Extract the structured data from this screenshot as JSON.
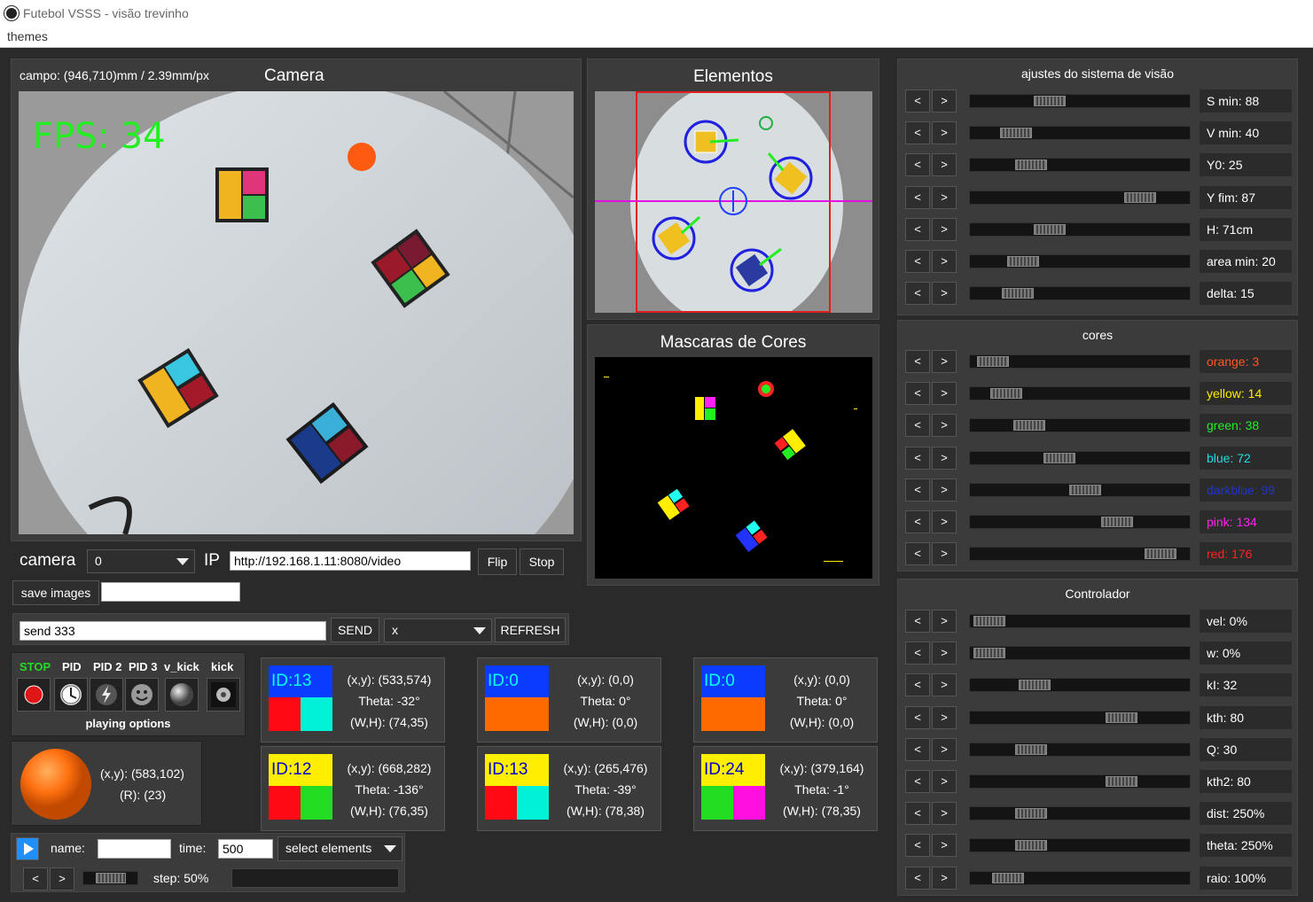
{
  "window": {
    "title": "Futebol VSSS - visão trevinho",
    "menu": [
      "themes"
    ]
  },
  "camera_panel": {
    "title": "Camera",
    "info": "campo: (946,710)mm / 2.39mm/px",
    "fps": "FPS: 34"
  },
  "elements_panel": {
    "title": "Elementos"
  },
  "masks_panel": {
    "title": "Mascaras de Cores"
  },
  "camera_controls": {
    "camera_label": "camera",
    "camera_select": "0",
    "ip_label": "IP",
    "ip_value": "http://192.168.1.11:8080/video",
    "flip": "Flip",
    "stop": "Stop",
    "save_images": "save images",
    "save_value": ""
  },
  "send_bar": {
    "value": "send 333",
    "send": "SEND",
    "select": "x",
    "refresh": "REFRESH"
  },
  "playing": {
    "labels": [
      "STOP",
      "PID",
      "PID 2",
      "PID 3",
      "v_kick",
      "kick"
    ],
    "footer": "playing options",
    "stop_color": "#22dd22"
  },
  "ball": {
    "xy": "(x,y): (583,102)",
    "r": "(R): (23)"
  },
  "robots": [
    {
      "id": "ID:13",
      "xy": "(x,y): (533,574)",
      "theta": "Theta: -32°",
      "wh": "(W,H): (74,35)",
      "team": "#0a3cff",
      "c1": "#ff0a14",
      "c2": "#00f0d8",
      "tc": "#00ffee"
    },
    {
      "id": "ID:0",
      "xy": "(x,y): (0,0)",
      "theta": "Theta: 0°",
      "wh": "(W,H): (0,0)",
      "team": "#0a3cff",
      "c1": "#ff6a00",
      "c2": "#ff6a00",
      "tc": "#00ffee"
    },
    {
      "id": "ID:0",
      "xy": "(x,y): (0,0)",
      "theta": "Theta: 0°",
      "wh": "(W,H): (0,0)",
      "team": "#0a3cff",
      "c1": "#ff6a00",
      "c2": "#ff6a00",
      "tc": "#00ffee"
    },
    {
      "id": "ID:12",
      "xy": "(x,y): (668,282)",
      "theta": "Theta: -136°",
      "wh": "(W,H): (76,35)",
      "team": "#ffee00",
      "c1": "#ff0a14",
      "c2": "#22dd22",
      "tc": "#0000cc"
    },
    {
      "id": "ID:13",
      "xy": "(x,y): (265,476)",
      "theta": "Theta: -39°",
      "wh": "(W,H): (78,38)",
      "team": "#ffee00",
      "c1": "#ff0a14",
      "c2": "#00f0d8",
      "tc": "#0000cc"
    },
    {
      "id": "ID:24",
      "xy": "(x,y): (379,164)",
      "theta": "Theta: -1°",
      "wh": "(W,H): (78,35)",
      "team": "#ffee00",
      "c1": "#22dd22",
      "c2": "#ff10e0",
      "tc": "#0000cc"
    }
  ],
  "recorder": {
    "name_label": "name:",
    "name_value": "",
    "time_label": "time:",
    "time_value": "500",
    "select": "select elements",
    "step": "step: 50%",
    "step_level": 0.5
  },
  "vision": {
    "title": "ajustes do sistema de visão",
    "sliders": [
      {
        "label": "S min: 88",
        "level": 0.34,
        "color": "#ffffff"
      },
      {
        "label": "V min: 40",
        "level": 0.16,
        "color": "#ffffff"
      },
      {
        "label": "Y0: 25",
        "level": 0.24,
        "color": "#ffffff"
      },
      {
        "label": "Y fim: 87",
        "level": 0.82,
        "color": "#ffffff"
      },
      {
        "label": "H: 71cm",
        "level": 0.34,
        "color": "#ffffff"
      },
      {
        "label": "area min: 20",
        "level": 0.2,
        "color": "#ffffff"
      },
      {
        "label": "delta: 15",
        "level": 0.17,
        "color": "#ffffff"
      }
    ]
  },
  "colors": {
    "title": "cores",
    "sliders": [
      {
        "label": "orange: 3",
        "level": 0.04,
        "color": "#ff5522"
      },
      {
        "label": "yellow: 14",
        "level": 0.11,
        "color": "#ffee00"
      },
      {
        "label": "green: 38",
        "level": 0.23,
        "color": "#22ee22"
      },
      {
        "label": "blue: 72",
        "level": 0.39,
        "color": "#22dddd"
      },
      {
        "label": "darkblue: 99",
        "level": 0.53,
        "color": "#2233cc"
      },
      {
        "label": "pink: 134",
        "level": 0.7,
        "color": "#ff22ee"
      },
      {
        "label": "red: 176",
        "level": 0.93,
        "color": "#ff2222"
      }
    ]
  },
  "controller": {
    "title": "Controlador",
    "sliders": [
      {
        "label": "vel: 0%",
        "level": 0.02,
        "color": "#ffffff"
      },
      {
        "label": "w: 0%",
        "level": 0.02,
        "color": "#ffffff"
      },
      {
        "label": "kI: 32",
        "level": 0.26,
        "color": "#ffffff"
      },
      {
        "label": "kth: 80",
        "level": 0.72,
        "color": "#ffffff"
      },
      {
        "label": "Q: 30",
        "level": 0.24,
        "color": "#ffffff"
      },
      {
        "label": "kth2: 80",
        "level": 0.72,
        "color": "#ffffff"
      },
      {
        "label": "dist: 250%",
        "level": 0.24,
        "color": "#ffffff"
      },
      {
        "label": "theta: 250%",
        "level": 0.24,
        "color": "#ffffff"
      },
      {
        "label": "raio: 100%",
        "level": 0.12,
        "color": "#ffffff"
      }
    ]
  }
}
